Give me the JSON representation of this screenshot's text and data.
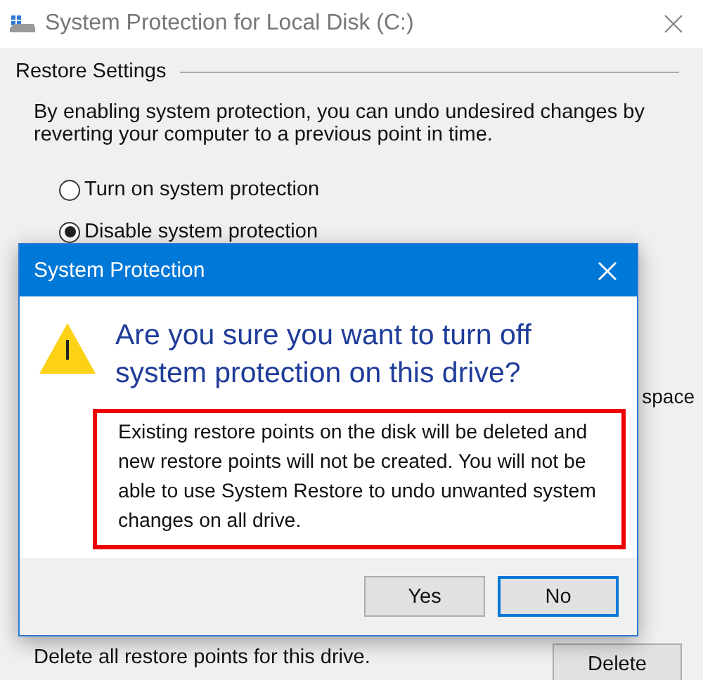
{
  "window": {
    "title": "System Protection for Local Disk (C:)"
  },
  "restore_settings": {
    "heading": "Restore Settings",
    "description": "By enabling system protection, you can undo undesired changes by reverting your computer to a previous point in time.",
    "options": [
      {
        "label": "Turn on system protection",
        "selected": false
      },
      {
        "label": "Disable system protection",
        "selected": true
      }
    ]
  },
  "partial_text": "space",
  "delete_section": {
    "description": "Delete all restore points for this drive.",
    "button": "Delete"
  },
  "dialog": {
    "title": "System Protection",
    "question": "Are you sure you want to turn off system protection on this drive?",
    "message": "Existing restore points on the disk will be deleted and new restore points will not be created. You will not be able to use System Restore to undo unwanted system changes on all drive.",
    "highlighted": true,
    "buttons": [
      {
        "label": "Yes",
        "default": false
      },
      {
        "label": "No",
        "default": true
      }
    ]
  }
}
